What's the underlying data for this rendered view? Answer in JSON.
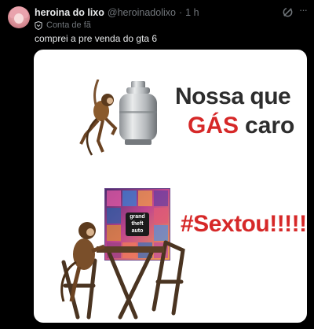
{
  "post": {
    "display_name": "heroina do lixo",
    "handle": "@heroinadolixo",
    "separator": "·",
    "time": "1 h",
    "badge_label": "Conta de fã",
    "text": "comprei a pre venda do gta 6",
    "more_label": "···"
  },
  "meme": {
    "line1": "Nossa que",
    "line2_highlight": "GÁS",
    "line2_rest": "caro",
    "line3": "#Sextou!!!!!",
    "cover_logo": "grand theft auto"
  },
  "colors": {
    "background": "#000000",
    "text_primary": "#e7e9ea",
    "text_secondary": "#71767b",
    "meme_red": "#d62828",
    "meme_dark": "#2d2d2d"
  },
  "icons": [
    "avatar",
    "shield-icon",
    "grok-icon",
    "more-icon",
    "gas-cylinder-image",
    "monkey-image",
    "gta-cover-image"
  ]
}
